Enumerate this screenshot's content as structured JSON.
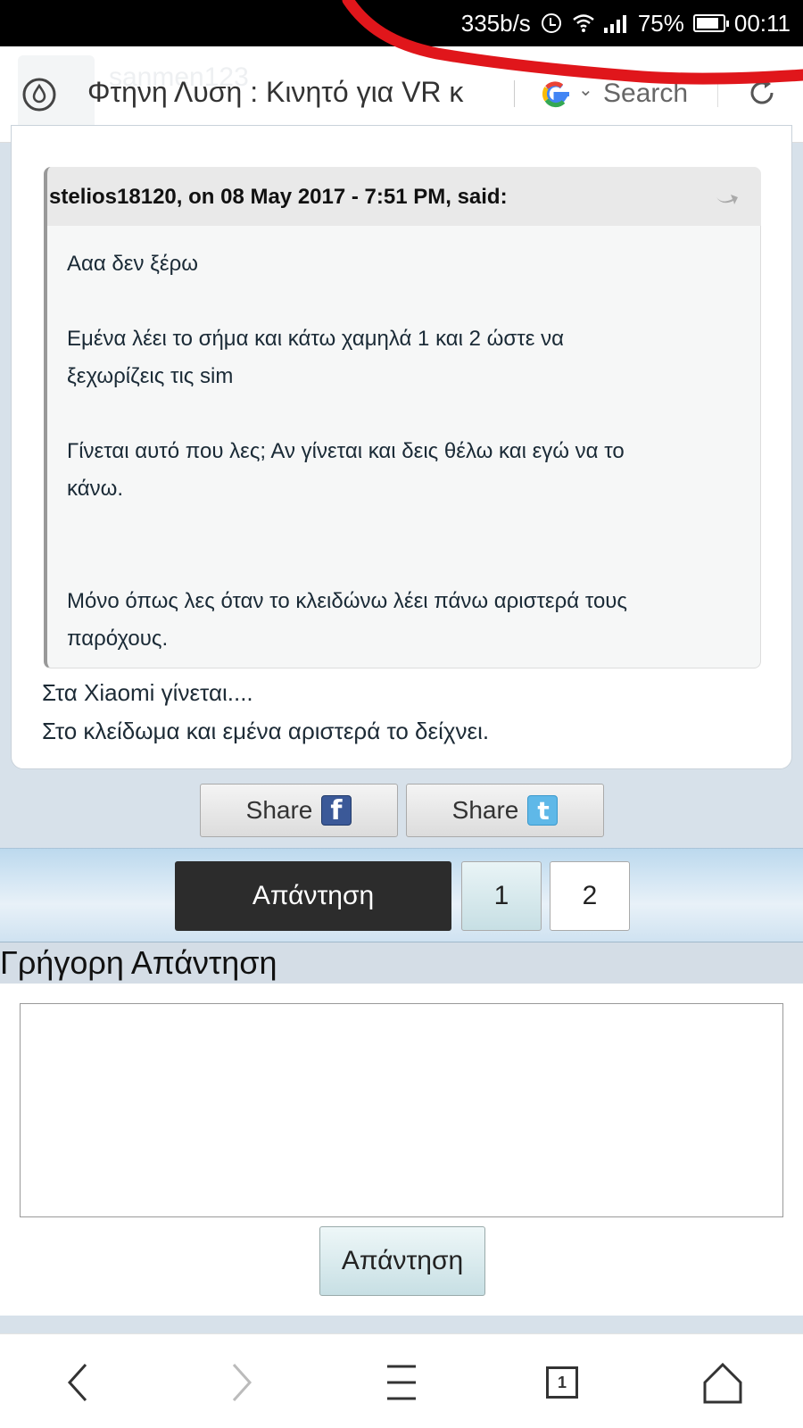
{
  "status_bar": {
    "network_speed": "335b/s",
    "battery_percent": "75%",
    "time": "00:11",
    "icons": [
      "alarm-icon",
      "wifi-icon",
      "signal-icon",
      "battery-icon"
    ]
  },
  "address_bar": {
    "ghost_username": "sanmen123",
    "page_title": "Φτηνη Λυση : Κινητό για VR κ",
    "search_label": "Search",
    "icons": [
      "drop-icon",
      "google-icon",
      "chevron-down-icon",
      "reload-icon"
    ]
  },
  "post": {
    "quote_author": "stelios18120, on 08 May 2017 - 7:51 PM, said:",
    "quote_lines": [
      "Ααα δεν ξέρω",
      "Εμένα λέει το σήμα και κάτω χαμηλά 1 και 2 ώστε να",
      "ξεχωρίζεις τις sim",
      "Γίνεται αυτό που λες; Αν γίνεται και δεις θέλω και εγώ να το",
      "κάνω.",
      "Μόνο όπως λες όταν το κλειδώνω λέει πάνω αριστερά τους",
      "παρόχους."
    ],
    "reply_lines": [
      "Στα Xiaomi γίνεται....",
      "Στο κλείδωμα και εμένα αριστερά το δείχνει."
    ]
  },
  "share": {
    "facebook_label": "Share",
    "twitter_label": "Share"
  },
  "pagination": {
    "reply_label": "Απάντηση",
    "pages": [
      "1",
      "2"
    ]
  },
  "quick_reply": {
    "heading": "Γρήγορη Απάντηση",
    "textarea_value": "",
    "submit_label": "Απάντηση"
  },
  "browser_nav": {
    "tab_count": "1",
    "icons": [
      "back-icon",
      "forward-icon",
      "menu-icon",
      "tabs-icon",
      "home-icon"
    ]
  },
  "colors": {
    "status_bar": "#000000",
    "annotation_red": "#e0161b",
    "reply_button": "#2c2c2c",
    "page_background": "#d7e1ea"
  }
}
